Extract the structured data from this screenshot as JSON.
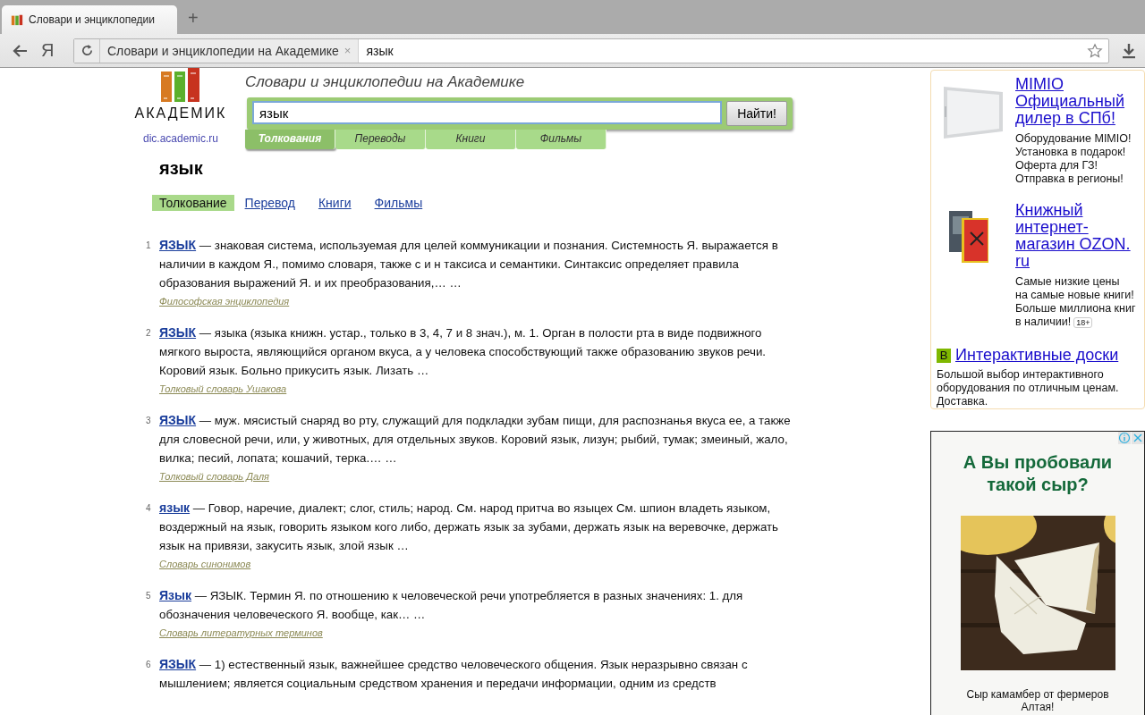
{
  "browser": {
    "tab_title": "Словари и энциклопедии",
    "new_tab": "+",
    "yandex_button": "Я",
    "omnibox": {
      "page_title": "Словари и энциклопедии на Академике",
      "clear": "×",
      "query": "язык"
    }
  },
  "site": {
    "logo_text": "АКАДЕМИК",
    "domain": "dic.academic.ru",
    "heading": "Словари и энциклопедии на Академике",
    "search": {
      "value": "язык",
      "button": "Найти!"
    },
    "search_tabs": [
      {
        "label": "Толкования",
        "selected": true
      },
      {
        "label": "Переводы",
        "selected": false
      },
      {
        "label": "Книги",
        "selected": false
      },
      {
        "label": "Фильмы",
        "selected": false
      }
    ]
  },
  "word": "язык",
  "sections": [
    {
      "label": "Толкование",
      "selected": true
    },
    {
      "label": "Перевод",
      "selected": false
    },
    {
      "label": "Книги",
      "selected": false
    },
    {
      "label": "Фильмы",
      "selected": false
    }
  ],
  "results": [
    {
      "number": "1",
      "term": "ЯЗЫК",
      "text": "— знаковая система, используемая для целей коммуникации и познания. Системность Я. выражается в наличии в каждом Я., помимо словаря, также с и н таксиса и семантики. Синтаксис определяет правила образования выражений Я. и их преобразования,… …",
      "source": "Философская энциклопедия"
    },
    {
      "number": "2",
      "term": "ЯЗЫК",
      "text": "— языка (языка книжн. устар., только в 3, 4, 7 и 8 знач.), м. 1. Орган в полости рта в виде подвижного мягкого выроста, являющийся органом вкуса, а у человека способствующий также образованию звуков речи. Коровий язык. Больно прикусить язык. Лизать …",
      "source": "Толковый словарь Ушакова"
    },
    {
      "number": "3",
      "term": "ЯЗЫК",
      "text": "— муж. мясистый снаряд во рту, служащий для подкладки зубам пищи, для распознанья вкуса ее, а также для словесной речи, или, у животных, для отдельных звуков. Коровий язык, лизун; рыбий, тумак; змеиный, жало, вилка; песий, лопата; кошачий, терка.… …",
      "source": "Толковый словарь Даля"
    },
    {
      "number": "4",
      "term": "язык",
      "text": "— Говор, наречие, диалект; слог, стиль; народ. См. народ притча во языцех См. шпион владеть языком, воздержный на язык, говорить языком кого либо, держать язык за зубами, держать язык на веревочке, держать язык на привязи, закусить язык, злой язык …",
      "source": "Словарь синонимов"
    },
    {
      "number": "5",
      "term": "Язык",
      "text": "— ЯЗЫК. Термин Я. по отношению к человеческой речи употребляется в разных значениях: 1. для обозначения человеческого Я. вообще, как… …",
      "source": "Словарь литературных терминов"
    },
    {
      "number": "6",
      "term": "ЯЗЫК",
      "text": "— 1) естественный язык, важнейшее средство человеческого общения. Язык неразрывно связан с мышлением; является социальным средством хранения и передачи информации, одним из средств"
    }
  ],
  "ads": [
    {
      "kind": "picture",
      "title": "MIMIO\nОфициальный\nдилер в СПб!",
      "text": "Оборудование MIMIO!\nУстановка в подарок!\nОферта для ГЗ!\nОтправка в регионы!"
    },
    {
      "kind": "picture",
      "title": "Книжный\nинтернет-\nмагазин OZON.\nru",
      "text": "Самые низкие цены\nна самые новые книги!\nБольше миллиона книг\nв наличии!",
      "age": "18+"
    },
    {
      "kind": "lettered",
      "badge": "В",
      "title": "Интерактивные доски",
      "text": "Большой выбор интерактивного\nоборудования по отличным ценам.\nДоставка."
    }
  ],
  "banner": {
    "heading": "А Вы пробовали такой сыр?",
    "caption": "Сыр камамбер от фермеров Алтая!"
  }
}
